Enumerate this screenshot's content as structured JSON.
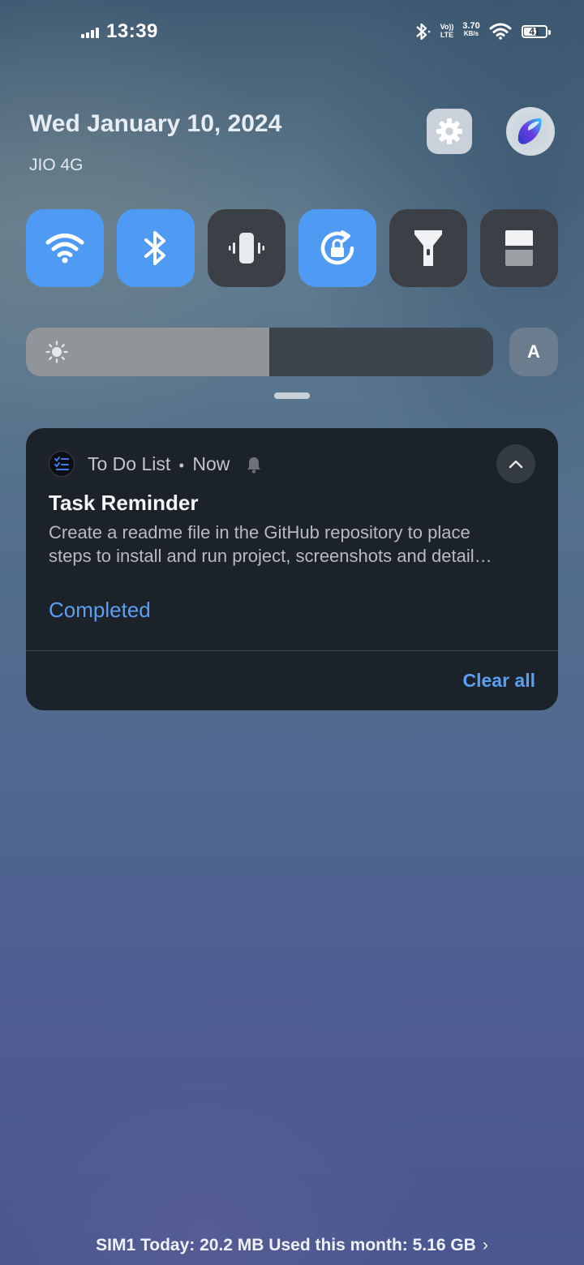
{
  "status_bar": {
    "time": "13:39",
    "volte_line1": "Vo))",
    "volte_line2": "LTE",
    "net_speed_value": "3.70",
    "net_speed_unit": "KB/s",
    "battery": "41"
  },
  "header": {
    "date": "Wed January 10, 2024",
    "carrier": "JIO 4G"
  },
  "quick_tiles": [
    {
      "name": "wifi",
      "active": true
    },
    {
      "name": "bluetooth",
      "active": true
    },
    {
      "name": "vibrate",
      "active": false
    },
    {
      "name": "auto-rotate",
      "active": true
    },
    {
      "name": "flashlight",
      "active": false
    },
    {
      "name": "screen-split",
      "active": false
    }
  ],
  "brightness": {
    "level": 0.52,
    "auto_label": "A"
  },
  "notification": {
    "app_name": "To Do List",
    "separator": "•",
    "time": "Now",
    "title": "Task Reminder",
    "body_line1": "Create a readme file in the GitHub repository to place",
    "body_line2": "steps to install and run project, screenshots and detail…",
    "action": "Completed",
    "clear_all": "Clear all"
  },
  "footer": {
    "text": "SIM1 Today: 20.2 MB Used this month: 5.16 GB",
    "chevron": "›"
  },
  "colors": {
    "accent": "#5b9ff2",
    "tile_on": "#4f9bf4",
    "tile_off": "#3b4046",
    "card_bg": "#1c2229"
  }
}
